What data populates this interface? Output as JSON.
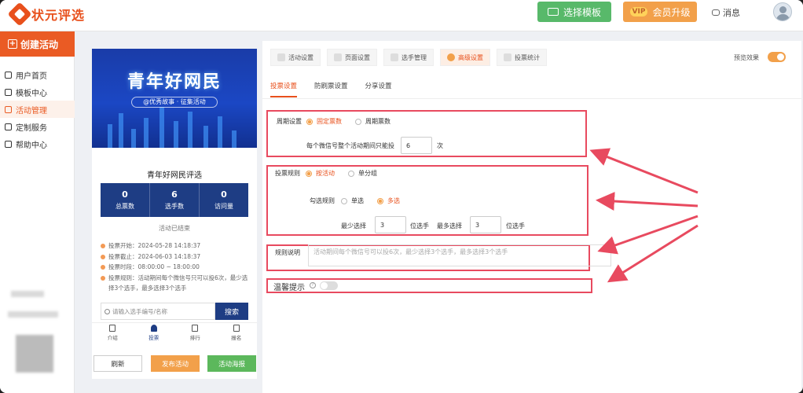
{
  "app": {
    "logo_text": "状元评选"
  },
  "header": {
    "template_button": "选择模板",
    "vip_badge": "VIP",
    "vip_button": "会员升级",
    "messages": "消息"
  },
  "sidebar": {
    "create_button": "创建活动",
    "items": [
      {
        "label": "用户首页",
        "icon": "home-icon"
      },
      {
        "label": "模板中心",
        "icon": "folder-icon"
      },
      {
        "label": "活动管理",
        "icon": "list-icon",
        "active": true
      },
      {
        "label": "定制服务",
        "icon": "cart-icon"
      },
      {
        "label": "帮助中心",
        "icon": "help-icon"
      }
    ]
  },
  "preview": {
    "banner_title": "青年好网民",
    "banner_subtitle": "@优秀故事 · 征集活动",
    "title": "青年好网民评选",
    "stats": [
      {
        "value": "0",
        "label": "总票数"
      },
      {
        "value": "6",
        "label": "选手数"
      },
      {
        "value": "0",
        "label": "访问量"
      }
    ],
    "status": "活动已结束",
    "info": [
      "投票开始：2024-05-28 14:18:37",
      "投票截止：2024-06-03 14:18:37",
      "投票时段：08:00:00 ~ 18:00:00",
      "投票规则：活动期间每个微信号只可以投6次，最少选择3个选手，最多选择3个选手"
    ],
    "search_placeholder": "请输入选手编号/名称",
    "search_button": "搜索",
    "tabs": [
      "介绍",
      "投票",
      "排行",
      "报名"
    ],
    "active_tab": "投票",
    "buttons": {
      "refresh": "刷新",
      "publish": "发布活动",
      "poster": "活动海报"
    }
  },
  "settings": {
    "steps": [
      "活动设置",
      "页面设置",
      "选手管理",
      "高级设置",
      "投票统计"
    ],
    "active_step": "高级设置",
    "preview_label": "预览效果",
    "preview_on": true,
    "subtabs": [
      "投票设置",
      "防刷票设置",
      "分享设置"
    ],
    "active_subtab": "投票设置",
    "cycle": {
      "label": "周期设置",
      "options": [
        "固定票数",
        "周期票数"
      ],
      "selected": "固定票数",
      "per_user_prefix": "每个微信号整个活动期间只能投",
      "per_user_value": "6",
      "per_user_suffix": "次"
    },
    "rule": {
      "label": "投票规则",
      "options": [
        "按活动",
        "单分组"
      ],
      "selected": "按活动",
      "select_label": "勾选规则",
      "select_options": [
        "单选",
        "多选"
      ],
      "select_selected": "多选",
      "min_label": "最少选择",
      "min_value": "3",
      "min_unit": "位选手",
      "max_label": "最多选择",
      "max_value": "3",
      "max_unit": "位选手"
    },
    "rule_desc": {
      "label": "规则说明",
      "text": "活动期间每个微信号可以投6次，最少选择3个选手，最多选择3个选手"
    },
    "tip": {
      "label": "温馨提示",
      "enabled": false
    }
  },
  "colors": {
    "brand": "#e8501c",
    "accent": "#f2a04a",
    "navy": "#1e3d84",
    "annotation": "#e84a5f"
  }
}
